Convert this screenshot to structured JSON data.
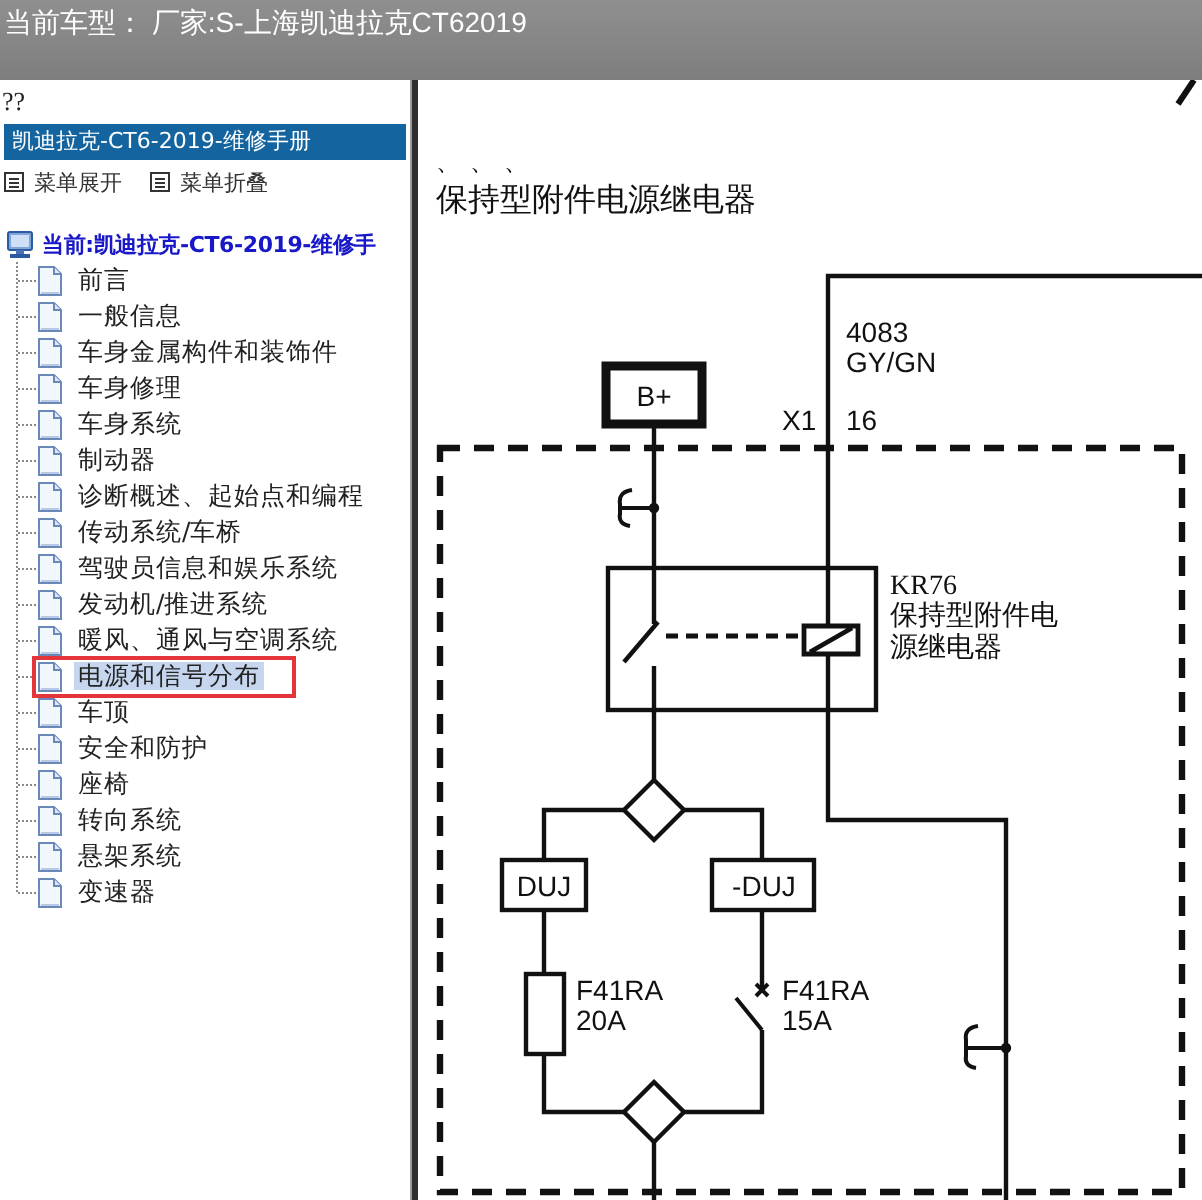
{
  "top_bar": {
    "title": "当前车型： 厂家:S-上海凯迪拉克CT62019"
  },
  "sidebar": {
    "marker": "??",
    "header": "凯迪拉克-CT6-2019-维修手册",
    "menu_buttons": [
      {
        "label": "菜单展开"
      },
      {
        "label": "菜单折叠"
      }
    ],
    "tree": {
      "root": "当前:凯迪拉克-CT6-2019-维修手",
      "children": [
        {
          "label": "前言",
          "selected": false,
          "outlined": false
        },
        {
          "label": "一般信息",
          "selected": false,
          "outlined": false
        },
        {
          "label": "车身金属构件和装饰件",
          "selected": false,
          "outlined": false
        },
        {
          "label": "车身修理",
          "selected": false,
          "outlined": false
        },
        {
          "label": "车身系统",
          "selected": false,
          "outlined": false
        },
        {
          "label": "制动器",
          "selected": false,
          "outlined": false
        },
        {
          "label": "诊断概述、起始点和编程",
          "selected": false,
          "outlined": false
        },
        {
          "label": "传动系统/车桥",
          "selected": false,
          "outlined": false
        },
        {
          "label": "驾驶员信息和娱乐系统",
          "selected": false,
          "outlined": false
        },
        {
          "label": "发动机/推进系统",
          "selected": false,
          "outlined": false
        },
        {
          "label": "暖风、通风与空调系统",
          "selected": false,
          "outlined": false
        },
        {
          "label": "电源和信号分布",
          "selected": true,
          "outlined": true
        },
        {
          "label": "车顶",
          "selected": false,
          "outlined": false
        },
        {
          "label": "安全和防护",
          "selected": false,
          "outlined": false
        },
        {
          "label": "座椅",
          "selected": false,
          "outlined": false
        },
        {
          "label": "转向系统",
          "selected": false,
          "outlined": false
        },
        {
          "label": "悬架系统",
          "selected": false,
          "outlined": false
        },
        {
          "label": "变速器",
          "selected": false,
          "outlined": false
        }
      ]
    }
  },
  "content": {
    "marks": "、、、",
    "title": "保持型附件电源继电器",
    "diagram": {
      "wire": {
        "circuit": "4083",
        "color_code": "GY/GN"
      },
      "connector": {
        "name": "X1",
        "pin": "16"
      },
      "power": "B+",
      "relay": {
        "name": "KR76",
        "description_lines": [
          "保持型附件电",
          "源继电器"
        ]
      },
      "branches": [
        {
          "option": "DUJ",
          "kind": "fuse",
          "name": "F41RA",
          "rating": "20A"
        },
        {
          "option": "-DUJ",
          "kind": "breaker",
          "name": "F41RA",
          "rating": "15A"
        }
      ]
    }
  }
}
